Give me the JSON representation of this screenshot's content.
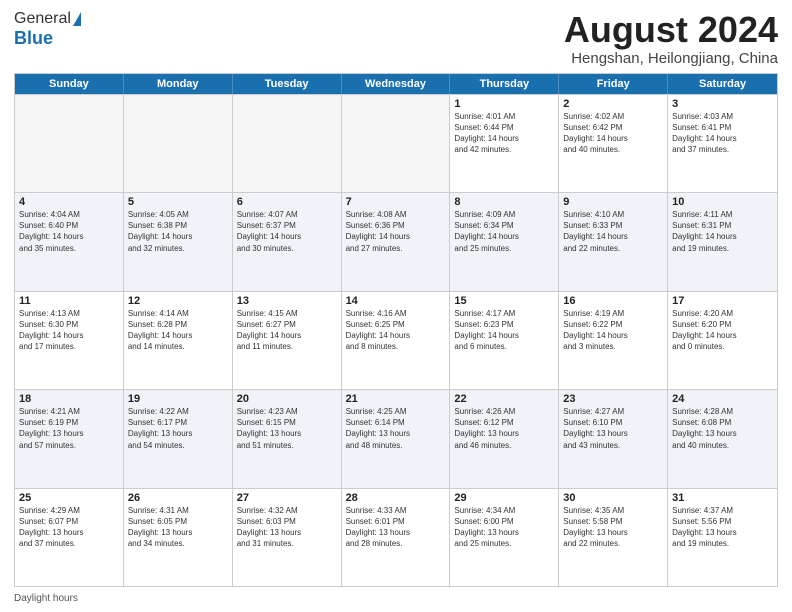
{
  "logo": {
    "line1": "General",
    "line2": "Blue"
  },
  "header": {
    "month": "August 2024",
    "location": "Hengshan, Heilongjiang, China"
  },
  "weekdays": [
    "Sunday",
    "Monday",
    "Tuesday",
    "Wednesday",
    "Thursday",
    "Friday",
    "Saturday"
  ],
  "rows": [
    [
      {
        "day": "",
        "info": ""
      },
      {
        "day": "",
        "info": ""
      },
      {
        "day": "",
        "info": ""
      },
      {
        "day": "",
        "info": ""
      },
      {
        "day": "1",
        "info": "Sunrise: 4:01 AM\nSunset: 6:44 PM\nDaylight: 14 hours\nand 42 minutes."
      },
      {
        "day": "2",
        "info": "Sunrise: 4:02 AM\nSunset: 6:42 PM\nDaylight: 14 hours\nand 40 minutes."
      },
      {
        "day": "3",
        "info": "Sunrise: 4:03 AM\nSunset: 6:41 PM\nDaylight: 14 hours\nand 37 minutes."
      }
    ],
    [
      {
        "day": "4",
        "info": "Sunrise: 4:04 AM\nSunset: 6:40 PM\nDaylight: 14 hours\nand 35 minutes."
      },
      {
        "day": "5",
        "info": "Sunrise: 4:05 AM\nSunset: 6:38 PM\nDaylight: 14 hours\nand 32 minutes."
      },
      {
        "day": "6",
        "info": "Sunrise: 4:07 AM\nSunset: 6:37 PM\nDaylight: 14 hours\nand 30 minutes."
      },
      {
        "day": "7",
        "info": "Sunrise: 4:08 AM\nSunset: 6:36 PM\nDaylight: 14 hours\nand 27 minutes."
      },
      {
        "day": "8",
        "info": "Sunrise: 4:09 AM\nSunset: 6:34 PM\nDaylight: 14 hours\nand 25 minutes."
      },
      {
        "day": "9",
        "info": "Sunrise: 4:10 AM\nSunset: 6:33 PM\nDaylight: 14 hours\nand 22 minutes."
      },
      {
        "day": "10",
        "info": "Sunrise: 4:11 AM\nSunset: 6:31 PM\nDaylight: 14 hours\nand 19 minutes."
      }
    ],
    [
      {
        "day": "11",
        "info": "Sunrise: 4:13 AM\nSunset: 6:30 PM\nDaylight: 14 hours\nand 17 minutes."
      },
      {
        "day": "12",
        "info": "Sunrise: 4:14 AM\nSunset: 6:28 PM\nDaylight: 14 hours\nand 14 minutes."
      },
      {
        "day": "13",
        "info": "Sunrise: 4:15 AM\nSunset: 6:27 PM\nDaylight: 14 hours\nand 11 minutes."
      },
      {
        "day": "14",
        "info": "Sunrise: 4:16 AM\nSunset: 6:25 PM\nDaylight: 14 hours\nand 8 minutes."
      },
      {
        "day": "15",
        "info": "Sunrise: 4:17 AM\nSunset: 6:23 PM\nDaylight: 14 hours\nand 6 minutes."
      },
      {
        "day": "16",
        "info": "Sunrise: 4:19 AM\nSunset: 6:22 PM\nDaylight: 14 hours\nand 3 minutes."
      },
      {
        "day": "17",
        "info": "Sunrise: 4:20 AM\nSunset: 6:20 PM\nDaylight: 14 hours\nand 0 minutes."
      }
    ],
    [
      {
        "day": "18",
        "info": "Sunrise: 4:21 AM\nSunset: 6:19 PM\nDaylight: 13 hours\nand 57 minutes."
      },
      {
        "day": "19",
        "info": "Sunrise: 4:22 AM\nSunset: 6:17 PM\nDaylight: 13 hours\nand 54 minutes."
      },
      {
        "day": "20",
        "info": "Sunrise: 4:23 AM\nSunset: 6:15 PM\nDaylight: 13 hours\nand 51 minutes."
      },
      {
        "day": "21",
        "info": "Sunrise: 4:25 AM\nSunset: 6:14 PM\nDaylight: 13 hours\nand 48 minutes."
      },
      {
        "day": "22",
        "info": "Sunrise: 4:26 AM\nSunset: 6:12 PM\nDaylight: 13 hours\nand 46 minutes."
      },
      {
        "day": "23",
        "info": "Sunrise: 4:27 AM\nSunset: 6:10 PM\nDaylight: 13 hours\nand 43 minutes."
      },
      {
        "day": "24",
        "info": "Sunrise: 4:28 AM\nSunset: 6:08 PM\nDaylight: 13 hours\nand 40 minutes."
      }
    ],
    [
      {
        "day": "25",
        "info": "Sunrise: 4:29 AM\nSunset: 6:07 PM\nDaylight: 13 hours\nand 37 minutes."
      },
      {
        "day": "26",
        "info": "Sunrise: 4:31 AM\nSunset: 6:05 PM\nDaylight: 13 hours\nand 34 minutes."
      },
      {
        "day": "27",
        "info": "Sunrise: 4:32 AM\nSunset: 6:03 PM\nDaylight: 13 hours\nand 31 minutes."
      },
      {
        "day": "28",
        "info": "Sunrise: 4:33 AM\nSunset: 6:01 PM\nDaylight: 13 hours\nand 28 minutes."
      },
      {
        "day": "29",
        "info": "Sunrise: 4:34 AM\nSunset: 6:00 PM\nDaylight: 13 hours\nand 25 minutes."
      },
      {
        "day": "30",
        "info": "Sunrise: 4:35 AM\nSunset: 5:58 PM\nDaylight: 13 hours\nand 22 minutes."
      },
      {
        "day": "31",
        "info": "Sunrise: 4:37 AM\nSunset: 5:56 PM\nDaylight: 13 hours\nand 19 minutes."
      }
    ]
  ],
  "footer": {
    "note": "Daylight hours"
  }
}
